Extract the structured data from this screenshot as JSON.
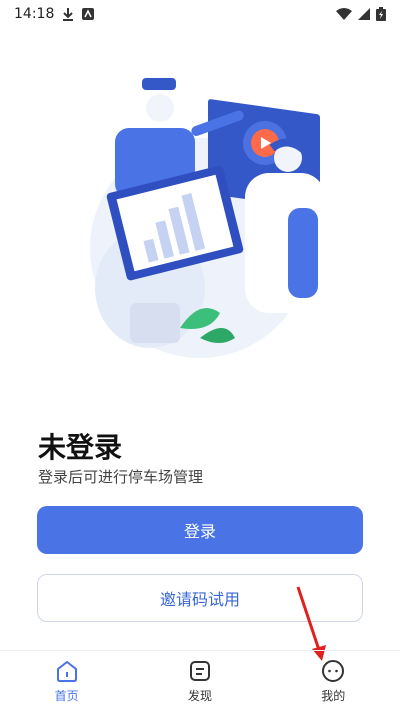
{
  "status": {
    "time": "14:18"
  },
  "header": {
    "title": "未登录",
    "subtitle": "登录后可进行停车场管理"
  },
  "actions": {
    "login_label": "登录",
    "invite_label": "邀请码试用"
  },
  "tabs": [
    {
      "label": "首页",
      "icon": "home-icon",
      "active": true
    },
    {
      "label": "发现",
      "icon": "discover-icon",
      "active": false
    },
    {
      "label": "我的",
      "icon": "profile-icon",
      "active": false
    }
  ],
  "colors": {
    "accent": "#4a74e6",
    "arrow": "#e02020"
  }
}
